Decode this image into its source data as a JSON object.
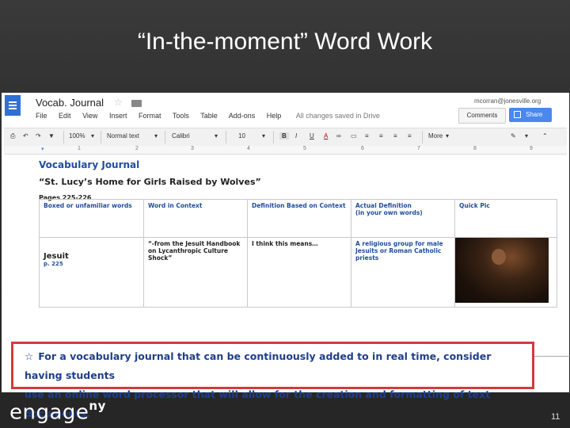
{
  "slide": {
    "title": "“In-the-moment” Word Work",
    "logo_text": "engage",
    "logo_superscript": "ny",
    "page_number": "11"
  },
  "app": {
    "doc_title": "Vocab. Journal",
    "account": "mcorran@jonesville.org",
    "menu": [
      "File",
      "Edit",
      "View",
      "Insert",
      "Format",
      "Tools",
      "Table",
      "Add-ons",
      "Help"
    ],
    "save_status": "All changes saved in Drive",
    "comments_label": "Comments",
    "share_label": "Share"
  },
  "toolbar": {
    "zoom": "100%",
    "style": "Normal text",
    "font": "Calibri",
    "size": "10",
    "more": "More"
  },
  "ruler_marks": [
    "1",
    "2",
    "3",
    "4",
    "5",
    "6",
    "7",
    "8",
    "9"
  ],
  "document": {
    "heading": "Vocabulary Journal",
    "book": "“St. Lucy’s Home for Girls Raised by Wolves”",
    "pages": "Pages 225-226",
    "table": {
      "headers": [
        "Boxed or unfamiliar words",
        "Word in Context",
        "Definition Based on Context",
        "Actual Definition\n(in your own words)",
        "Quick Pic"
      ],
      "row": {
        "word": "Jesuit",
        "page": "p. 225",
        "context": "“-from the Jesuit Handbook on Lycanthropic Culture Shock”",
        "guess": "I think this means…",
        "definition": "A religious group for male Jesuits or Roman Catholic priests"
      }
    }
  },
  "callout": {
    "line1": "For a vocabulary journal that can be continuously added to in real time, consider having students",
    "line2": "use an online word processor that will allow for the creation and formatting of text documents.",
    "accent": "#d43b3b"
  }
}
